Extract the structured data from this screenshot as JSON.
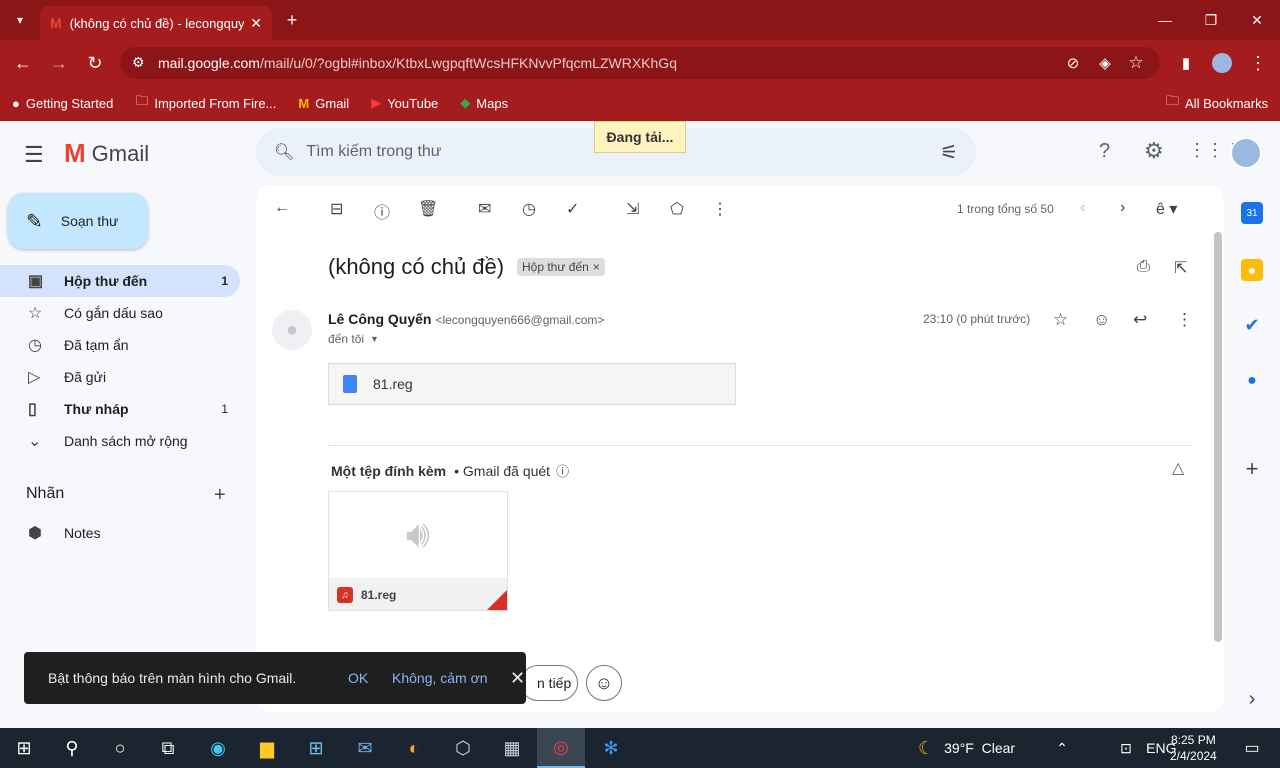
{
  "browser": {
    "tab_title": "(không có chủ đề) - lecongquyen",
    "url_domain": "mail.google.com",
    "url_path": "/mail/u/0/?ogbl#inbox/KtbxLwgpqftWcsHFKNvvPfqcmLZWRXKhGq",
    "bookmarks": [
      "Getting Started",
      "Imported From Fire...",
      "Gmail",
      "YouTube",
      "Maps"
    ],
    "all_bookmarks": "All Bookmarks"
  },
  "gmail": {
    "logo": "Gmail",
    "search_placeholder": "Tìm kiếm trong thư",
    "loading": "Đang tải...",
    "compose": "Soạn thư",
    "nav": [
      {
        "label": "Hộp thư đến",
        "count": "1"
      },
      {
        "label": "Có gắn dấu sao",
        "count": ""
      },
      {
        "label": "Đã tạm ẩn",
        "count": ""
      },
      {
        "label": "Đã gửi",
        "count": ""
      },
      {
        "label": "Thư nháp",
        "count": "1"
      },
      {
        "label": "Danh sách mở rộng",
        "count": ""
      }
    ],
    "labels_title": "Nhãn",
    "labels": [
      "Notes"
    ],
    "pager": "1 trong tổng số 50",
    "subject": "(không có chủ đề)",
    "inbox_chip": "Hộp thư đến",
    "sender_name": "Lê Công Quyến",
    "sender_email": "<lecongquyen666@gmail.com>",
    "recipient": "đến tôi",
    "timestamp": "23:10 (0 phút trước)",
    "attachment_name": "81.reg",
    "attachments_header": "Một tệp đính kèm",
    "scan_note": "• Gmail đã quét",
    "reply_partial": "n tiếp"
  },
  "snackbar": {
    "message": "Bật thông báo trên màn hình cho Gmail.",
    "ok": "OK",
    "no": "Không, cảm ơn"
  },
  "taskbar": {
    "weather": "39°F  Clear",
    "lang": "ENG",
    "time": "8:25 PM",
    "date": "2/4/2024"
  },
  "colors": {
    "browser_frame": "#a51c1f",
    "compose_bg": "#c2e7ff",
    "active_nav": "#d3e3fd"
  }
}
